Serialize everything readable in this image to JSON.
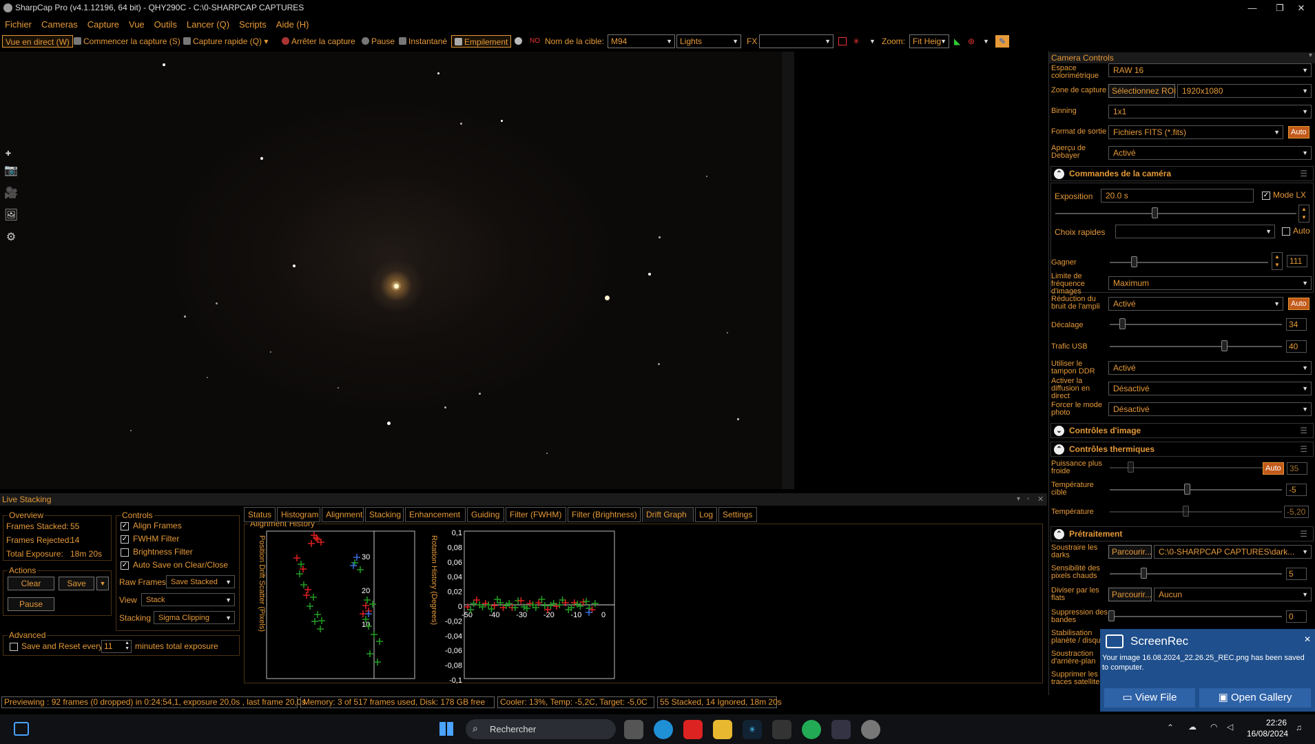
{
  "window": {
    "title": "SharpCap Pro (v4.1.12196, 64 bit) - QHY290C - C:\\0-SHARPCAP CAPTURES",
    "minimize": "—",
    "maximize": "❐",
    "close": "✕"
  },
  "menu": [
    "Fichier",
    "Cameras",
    "Capture",
    "Vue",
    "Outils",
    "Lancer (Q)",
    "Scripts",
    "Aide (H)"
  ],
  "toolbar": {
    "live_view": "Vue en direct (W)",
    "start_capture": "Commencer la capture (S)",
    "quick_capture": "Capture rapide (Q)",
    "stop_capture": "Arrêter la capture",
    "pause": "Pause",
    "snapshot": "Instantané",
    "stacking": "Empilement",
    "target_label": "Nom de la cible:",
    "target_value": "M94",
    "frame_type": "Lights",
    "fx_label": "FX",
    "fx_value": "",
    "zoom_label": "Zoom:",
    "zoom_value": "Fit Heig"
  },
  "camera_controls": {
    "title": "Camera Controls",
    "colour_space_label": "Espace colorimétrique",
    "colour_space_value": "RAW 16",
    "capture_area_label": "Zone de capture",
    "select_roi": "Sélectionnez ROI",
    "capture_area_value": "1920x1080",
    "binning_label": "Binning",
    "binning_value": "1x1",
    "output_format_label": "Format de sortie",
    "output_format_value": "Fichiers FITS (*.fits)",
    "auto": "Auto",
    "debayer_preview_label": "Aperçu de Debayer",
    "debayer_preview_value": "Activé",
    "section_camera": "Commandes de la caméra",
    "exposure_label": "Exposition",
    "exposure_value": "20.0 s",
    "lx_mode": "Mode LX",
    "quick_picks_label": "Choix rapides",
    "quick_picks_value": "",
    "gain_label": "Gagner",
    "gain_value": "111",
    "frame_rate_label": "Limite de fréquence d'images",
    "frame_rate_value": "Maximum",
    "amp_noise_label": "Réduction du bruit de l'ampli",
    "amp_noise_value": "Activé",
    "offset_label": "Décalage",
    "offset_value": "34",
    "usb_label": "Trafic USB",
    "usb_value": "40",
    "ddr_label": "Utiliser le tampon DDR",
    "ddr_value": "Activé",
    "live_stream_label": "Activer la diffusion en direct",
    "live_stream_value": "Désactivé",
    "photo_mode_label": "Forcer le mode photo",
    "photo_mode_value": "Désactivé",
    "section_image": "Contrôles d'image",
    "section_thermal": "Contrôles thermiques",
    "cooler_power_label": "Puissance plus froide",
    "cooler_power_value": "35",
    "target_temp_label": "Température cible",
    "target_temp_value": "-5",
    "temperature_label": "Température",
    "temperature_value": "-5,20",
    "section_preprocess": "Prétraitement",
    "subtract_darks_label": "Soustraire les darks",
    "browse": "Parcourir...",
    "darks_path": "C:\\0-SHARPCAP CAPTURES\\dark...",
    "hot_pixel_label": "Sensibilité des pixels chauds",
    "hot_pixel_value": "5",
    "divide_flats_label": "Diviser par les flats",
    "flats_value": "Aucun",
    "banding_label": "Suppression des bandes",
    "banding_value": "0",
    "stabilisation_label": "Stabilisation planète / disque",
    "background_label": "Soustraction d'arrière-plan",
    "satellite_label": "Supprimer les traces satellite"
  },
  "live_stacking": {
    "title": "Live Stacking",
    "overview_title": "Overview",
    "frames_stacked_label": "Frames Stacked:",
    "frames_stacked": "55",
    "frames_rejected_label": "Frames Rejected:",
    "frames_rejected": "14",
    "total_exposure_label": "Total Exposure:",
    "total_exposure": "18m 20s",
    "actions_title": "Actions",
    "clear": "Clear",
    "save": "Save",
    "pause": "Pause",
    "advanced_title": "Advanced",
    "save_reset_label": "Save and Reset every",
    "save_reset_value": "11",
    "save_reset_suffix": "minutes total exposure",
    "controls_title": "Controls",
    "align_frames": "Align Frames",
    "fwhm_filter": "FWHM Filter",
    "brightness_filter": "Brightness Filter",
    "auto_save": "Auto Save on Clear/Close",
    "raw_frames_label": "Raw Frames",
    "raw_frames_value": "Save Stacked",
    "view_label": "View",
    "view_value": "Stack",
    "stacking_label": "Stacking",
    "stacking_value": "Sigma Clipping",
    "tabs": [
      "Status",
      "Histogram",
      "Alignment",
      "Stacking",
      "Enhancement",
      "Guiding",
      "Filter (FWHM)",
      "Filter (Brightness)",
      "Drift Graph",
      "Log",
      "Settings"
    ],
    "active_tab": "Drift Graph",
    "alignment_history_title": "Alignment History",
    "scatter_ylabel": "Position Drift Scatter (Pixels)",
    "scatter_ticks": [
      "30",
      "20",
      "10"
    ],
    "rotation_ylabel": "Rotation History (Degrees)",
    "rotation_yticks": [
      "0,1",
      "0,08",
      "0,06",
      "0,04",
      "0,02",
      "0",
      "-0,02",
      "-0,04",
      "-0,06",
      "-0,08",
      "-0,1"
    ],
    "rotation_xticks": [
      "-50",
      "-40",
      "-30",
      "-20",
      "-10",
      "0"
    ]
  },
  "status_bar": {
    "preview": "Previewing : 92 frames (0 dropped) in 0:24:54,1, exposure 20,0s , last frame 20,0s",
    "memory": "Memory: 3 of 517 frames used, Disk: 178 GB free",
    "cooler": "Cooler: 13%, Temp: -5,2C, Target: -5,0C",
    "stacked": "55 Stacked, 14 Ignored, 18m 20s"
  },
  "toast": {
    "app": "ScreenRec",
    "message": "Your image 16.08.2024_22.26.25_REC.png has been saved to computer.",
    "view_file": "View File",
    "open_gallery": "Open Gallery",
    "close": "✕"
  },
  "taskbar": {
    "search_placeholder": "Rechercher",
    "time": "22:26",
    "date": "16/08/2024"
  },
  "colors": {
    "accent": "#e69a38",
    "auto_button": "#c25a1a",
    "toast": "#1f4f8c"
  }
}
